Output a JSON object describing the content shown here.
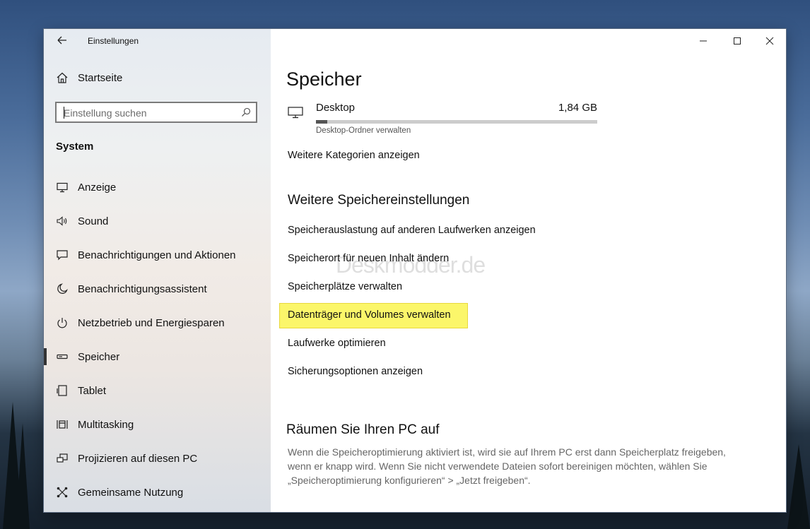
{
  "window": {
    "title": "Einstellungen",
    "back_icon": "back-arrow-icon",
    "controls": [
      "minimize-icon",
      "maximize-icon",
      "close-icon"
    ]
  },
  "sidebar": {
    "home": {
      "label": "Startseite",
      "icon": "home-icon"
    },
    "search": {
      "placeholder": "Einstellung suchen",
      "icon": "search-icon"
    },
    "section_heading": "System",
    "items": [
      {
        "label": "Anzeige",
        "icon": "display-icon"
      },
      {
        "label": "Sound",
        "icon": "speaker-icon"
      },
      {
        "label": "Benachrichtigungen und Aktionen",
        "icon": "notification-icon"
      },
      {
        "label": "Benachrichtigungsassistent",
        "icon": "moon-icon"
      },
      {
        "label": "Netzbetrieb und Energiesparen",
        "icon": "power-icon"
      },
      {
        "label": "Speicher",
        "icon": "storage-icon",
        "selected": true
      },
      {
        "label": "Tablet",
        "icon": "tablet-icon"
      },
      {
        "label": "Multitasking",
        "icon": "multitasking-icon"
      },
      {
        "label": "Projizieren auf diesen PC",
        "icon": "project-icon"
      },
      {
        "label": "Gemeinsame Nutzung",
        "icon": "share-icon"
      }
    ]
  },
  "main": {
    "title": "Speicher",
    "desktop": {
      "name": "Desktop",
      "size": "1,84 GB",
      "sub_link": "Desktop-Ordner verwalten",
      "usage_fraction": 0.04,
      "icon": "monitor-icon"
    },
    "more_categories": "Weitere Kategorien anzeigen",
    "more_settings_heading": "Weitere Speichereinstellungen",
    "more_settings_links": [
      "Speicherauslastung auf anderen Laufwerken anzeigen",
      "Speicherort für neuen Inhalt ändern",
      "Speicherplätze verwalten",
      "Datenträger und Volumes verwalten",
      "Laufwerke optimieren",
      "Sicherungsoptionen anzeigen"
    ],
    "highlighted_link_index": 3,
    "highlight_color": "#fbf66a",
    "cleanup_heading": "Räumen Sie Ihren PC auf",
    "cleanup_text": "Wenn die Speicheroptimierung aktiviert ist, wird sie auf Ihrem PC erst dann Speicherplatz freigeben, wenn er knapp wird. Wenn Sie nicht verwendete Dateien sofort bereinigen möchten, wählen Sie „Speicheroptimierung konfigurieren“ > „Jetzt freigeben“."
  },
  "watermark": "Deskmodder.de"
}
